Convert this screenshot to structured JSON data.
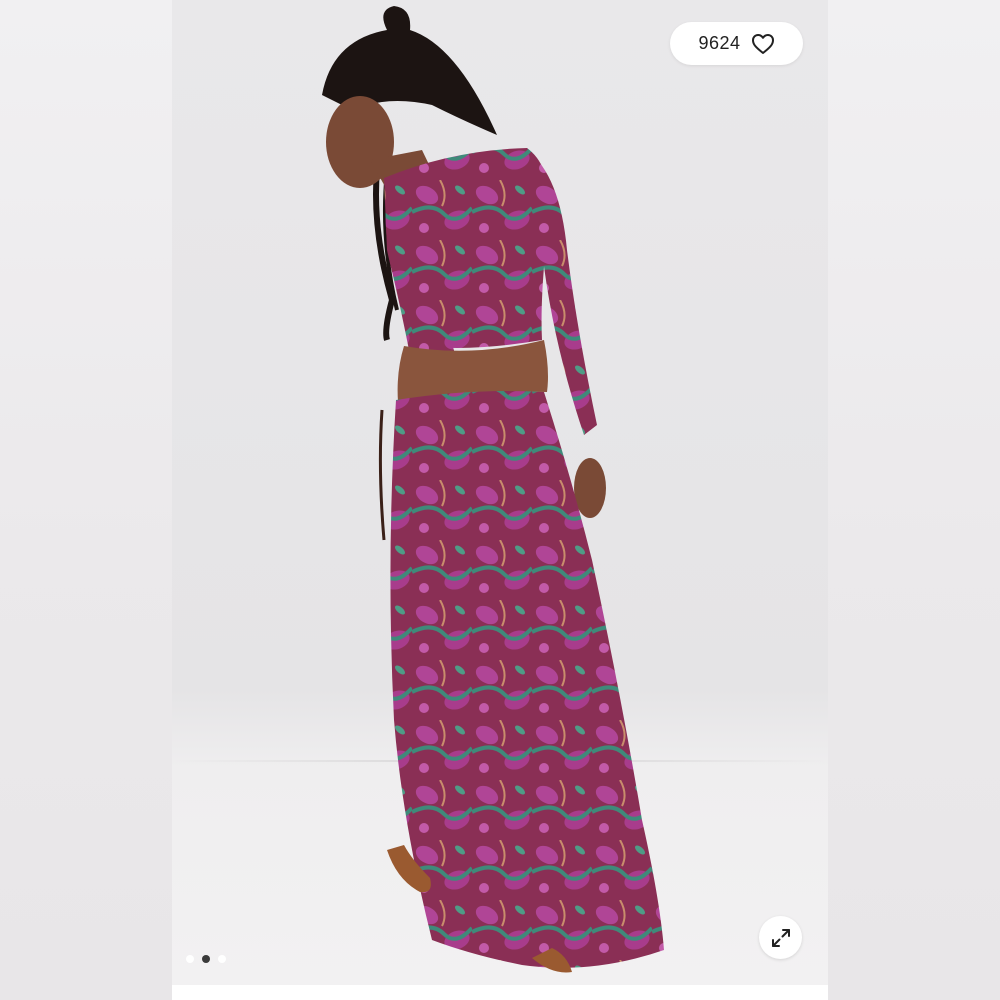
{
  "gallery": {
    "like_count": "9624",
    "slide_count": 3,
    "active_slide_index": 1
  },
  "icons": {
    "like": "heart-outline-icon",
    "expand": "expand-arrows-icon"
  },
  "colors": {
    "pill_background": "#ffffff",
    "text": "#222222",
    "dot_active": "#3a3a3a",
    "dot_inactive": "#ffffff"
  }
}
